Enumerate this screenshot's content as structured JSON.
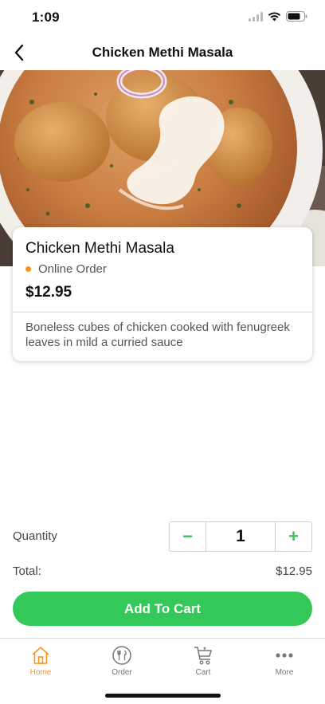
{
  "status_bar": {
    "time": "1:09"
  },
  "header": {
    "title": "Chicken Methi Masala",
    "back_icon": "chevron-left-icon"
  },
  "item": {
    "name": "Chicken Methi Masala",
    "order_type": "Online Order",
    "price": "$12.95",
    "description": "Boneless cubes of chicken cooked with fenugreek leaves in mild a curried sauce"
  },
  "quantity": {
    "label": "Quantity",
    "minus": "−",
    "value": "1",
    "plus": "+"
  },
  "total": {
    "label": "Total:",
    "value": "$12.95"
  },
  "add_to_cart": {
    "label": "Add To Cart"
  },
  "tabs": [
    {
      "label": "Home",
      "icon": "home-icon",
      "active": true
    },
    {
      "label": "Order",
      "icon": "plate-cutlery-icon",
      "active": false
    },
    {
      "label": "Cart",
      "icon": "cart-icon",
      "active": false
    },
    {
      "label": "More",
      "icon": "more-dots-icon",
      "active": false
    }
  ],
  "colors": {
    "accent_green": "#34c759",
    "accent_orange": "#f7941d",
    "text_dark": "#111111",
    "text_gray": "#555555"
  }
}
